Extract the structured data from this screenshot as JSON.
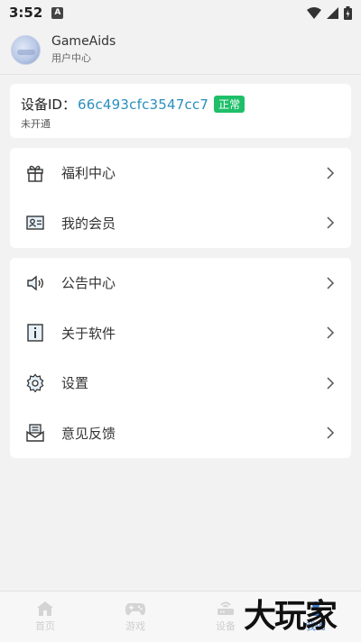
{
  "status_bar": {
    "time": "3:52",
    "notification_icon": "A"
  },
  "header": {
    "app_name": "GameAids",
    "subtitle": "用户中心"
  },
  "device": {
    "label": "设备ID：",
    "id": "66c493cfc3547cc7",
    "badge": "正常",
    "status": "未开通",
    "badge_color": "#1fbf6a",
    "id_color": "#2a8fbd"
  },
  "menu_group_1": [
    {
      "label": "福利中心",
      "icon": "gift-icon"
    },
    {
      "label": "我的会员",
      "icon": "id-card-icon"
    }
  ],
  "menu_group_2": [
    {
      "label": "公告中心",
      "icon": "speaker-icon"
    },
    {
      "label": "关于软件",
      "icon": "info-icon"
    },
    {
      "label": "设置",
      "icon": "gear-icon"
    },
    {
      "label": "意见反馈",
      "icon": "feedback-icon"
    }
  ],
  "tabs": [
    {
      "label": "首页",
      "icon": "home-icon"
    },
    {
      "label": "游戏",
      "icon": "gamepad-icon"
    },
    {
      "label": "设备",
      "icon": "router-icon"
    },
    {
      "label": "我的",
      "icon": "user-icon",
      "active": true
    }
  ],
  "watermark": "大玩家",
  "accent_color": "#3e7fd0"
}
